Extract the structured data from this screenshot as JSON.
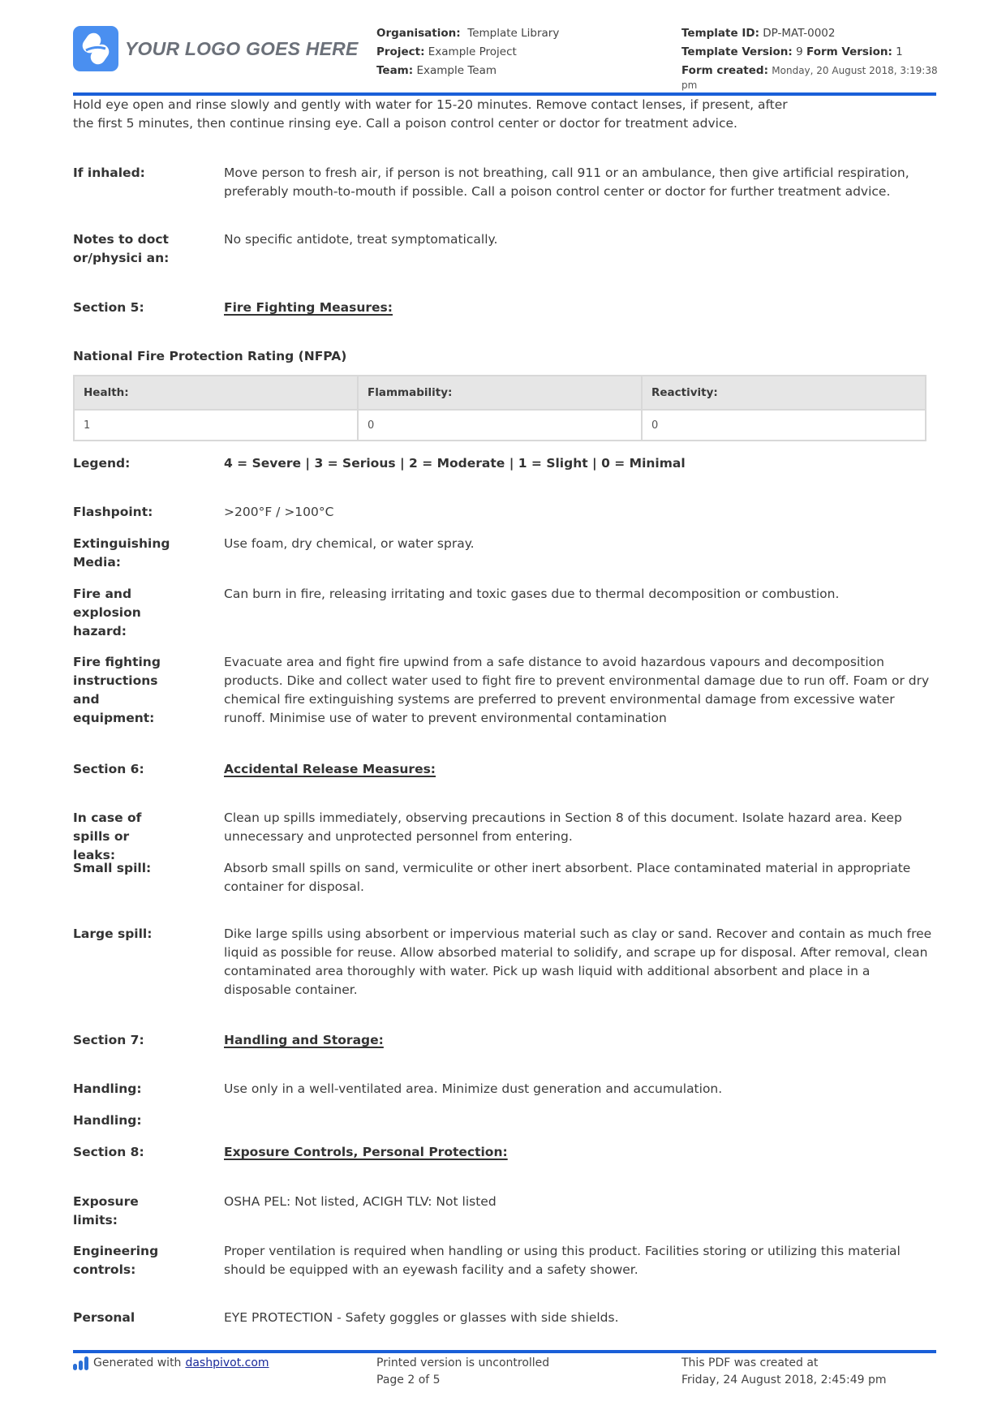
{
  "header": {
    "logo_text": "YOUR LOGO GOES HERE",
    "organisation_label": "Organisation:",
    "organisation_value": "Template Library",
    "project_label": "Project:",
    "project_value": "Example Project",
    "team_label": "Team:",
    "team_value": "Example Team",
    "template_id_label": "Template ID:",
    "template_id_value": "DP-MAT-0002",
    "template_version_label": "Template Version:",
    "template_version_value": "9",
    "form_version_label": "Form Version:",
    "form_version_value": "1",
    "form_created_label": "Form created:",
    "form_created_value": "Monday, 20 August 2018, 3:19:38",
    "form_created_suffix": "pm",
    "accent_color": "#1a5fd8"
  },
  "intro_paragraph": {
    "line1": "Hold eye open and rinse slowly and gently with water for 15-20 minutes. Remove contact lenses, if present, after",
    "line2": "the first 5 minutes, then continue rinsing eye. Call a poison control center or doctor for treatment advice."
  },
  "first_aid": [
    {
      "label": "If inhaled:",
      "value": "Move person to fresh air, if person is not breathing, call 911 or an ambulance, then give artificial respiration, preferably mouth-to-mouth if possible. Call a poison control center or doctor for further treatment advice."
    },
    {
      "label": "Notes to doctor/physici an:",
      "value": "No specific antidote, treat symptomatically."
    }
  ],
  "section5": {
    "label": "Section 5:",
    "title": "Fire Fighting Measures:",
    "nfpa_heading": "National Fire Protection Rating (NFPA)",
    "nfpa_table": {
      "headers": [
        "Health:",
        "Flammability:",
        "Reactivity:"
      ],
      "values": [
        "1",
        "0",
        "0"
      ]
    },
    "legend_label": "Legend:",
    "legend_value": "4 = Severe | 3 = Serious | 2 = Moderate | 1 = Slight | 0 = Minimal",
    "fields": [
      {
        "label": "Flashpoint:",
        "value": ">200°F / >100°C"
      },
      {
        "label": "Extinguishing Media:",
        "value": "Use foam, dry chemical, or water spray."
      },
      {
        "label": "Fire and explosion hazard:",
        "value": "Can burn in fire, releasing irritating and toxic gases due to thermal decomposition or combustion."
      },
      {
        "label": "Fire fighting instructions and equipment:",
        "value": "Evacuate area and fight fire upwind from a safe distance to avoid hazardous vapours and decomposition products. Dike and collect water used to fight fire to prevent environmental damage due to run off. Foam or dry chemical fire extinguishing systems are preferred to prevent environmental damage from excessive water runoff. Minimise use of water to prevent environmental contamination"
      }
    ]
  },
  "section6": {
    "label": "Section 6:",
    "title": "Accidental Release Measures:",
    "fields": [
      {
        "label": "In case of spills or leaks:",
        "value": "Clean up spills immediately, observing precautions in Section 8 of this document. Isolate hazard area. Keep unnecessary and unprotected personnel from entering."
      },
      {
        "label": "Small spill:",
        "value": "Absorb small spills on sand, vermiculite or other inert absorbent. Place contaminated material in appropriate container for disposal."
      },
      {
        "label": "Large spill:",
        "value": "Dike large spills using absorbent or impervious material such as clay or sand. Recover and contain as much free liquid as possible for reuse. Allow absorbed material to solidify, and scrape up for disposal. After removal, clean contaminated area thoroughly with water. Pick up wash liquid with additional absorbent and place in a disposable container."
      }
    ]
  },
  "section7": {
    "label": "Section 7:",
    "title": "Handling and Storage:",
    "fields": [
      {
        "label": "Handling:",
        "value": "Use only in a well-ventilated area. Minimize dust generation and accumulation."
      },
      {
        "label": "Handling:",
        "value": ""
      }
    ]
  },
  "section8": {
    "label": "Section 8:",
    "title": "Exposure Controls, Personal Protection:",
    "fields": [
      {
        "label": "Exposure limits:",
        "value": "OSHA PEL: Not listed, ACIGH TLV: Not listed"
      },
      {
        "label": "Engineering controls:",
        "value": "Proper ventilation is required when handling or using this product. Facilities storing or utilizing this material should be equipped with an eyewash facility and a safety shower."
      },
      {
        "label": "Personal",
        "value": "EYE PROTECTION - Safety goggles or glasses with side shields."
      }
    ]
  },
  "footer": {
    "generated_text": "Generated with",
    "generated_link": "dashpivot.com",
    "uncontrolled_text": "Printed version is uncontrolled",
    "page_text": "Page 2 of 5",
    "pdf_created_text": "This PDF was created at",
    "pdf_created_value": "Friday, 24 August 2018, 2:45:49 pm"
  }
}
